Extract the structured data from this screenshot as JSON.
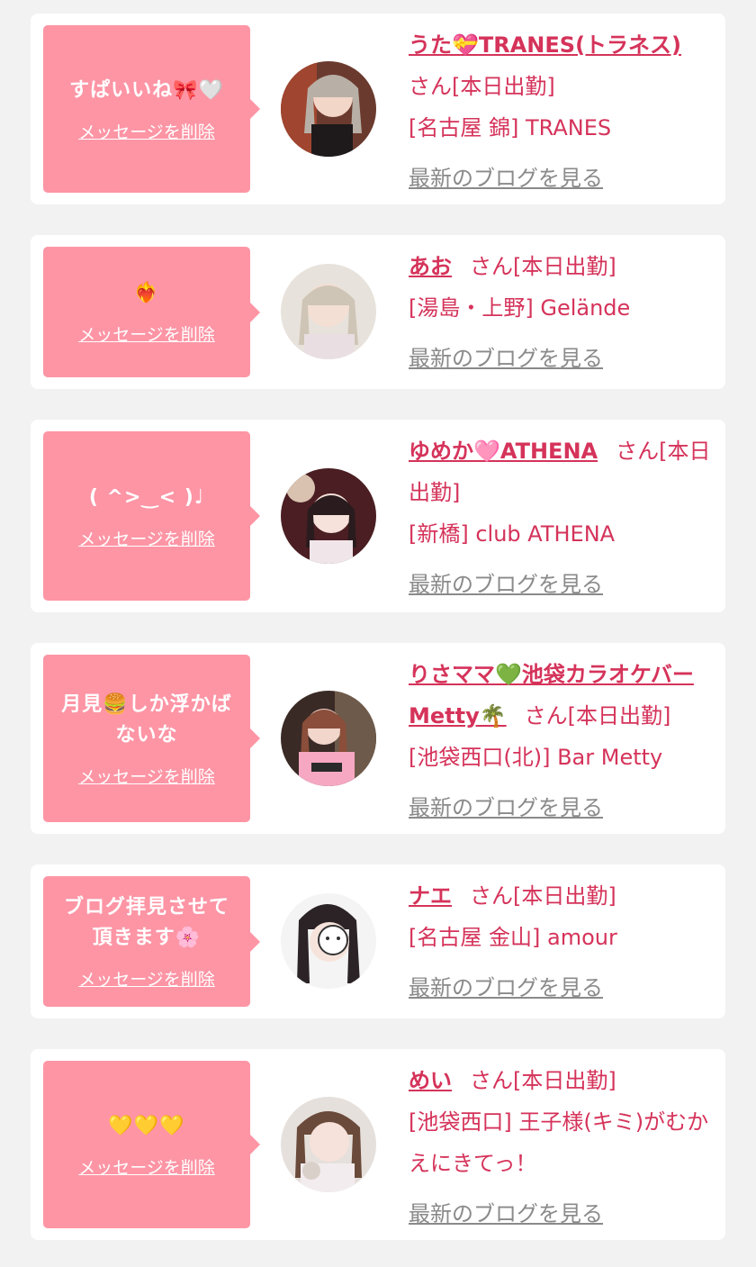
{
  "delete_label": "メッセージを削除",
  "blog_label": "最新のブログを見る",
  "colors": {
    "accent": "#d5335a",
    "bubble": "#fd95a5",
    "link_gray": "#8a8a8a",
    "card": "#ffffff",
    "background": "#f2f2f2"
  },
  "cards": [
    {
      "message_lines": [
        "すぱいいね🎀🤍"
      ],
      "name": "うた💝TRANES(トラネス)",
      "status": "さん[本日出勤]",
      "location": "[名古屋 錦] TRANES"
    },
    {
      "message_lines": [
        "❤️‍🔥"
      ],
      "name": "あお",
      "status": "さん[本日出勤]",
      "location": "[湯島・上野] Gelände"
    },
    {
      "message_lines": [
        "( ^>‿< )♩"
      ],
      "name": "ゆめか🩷ATHENA",
      "status": "さん[本日出勤]",
      "location": "[新橋] club ATHENA"
    },
    {
      "message_lines": [
        "月見🍔しか浮かば",
        "ないな"
      ],
      "name": "りさママ💚池袋カラオケバーMetty🌴",
      "status": "さん[本日出勤]",
      "location": "[池袋西口(北)] Bar Metty"
    },
    {
      "message_lines": [
        "ブログ拝見させて",
        "頂きます🌸"
      ],
      "name": "ナエ",
      "status": "さん[本日出勤]",
      "location": "[名古屋 金山] amour"
    },
    {
      "message_lines": [
        "💛💛💛"
      ],
      "name": "めい",
      "status": "さん[本日出勤]",
      "location": "[池袋西口] 王子様(キミ)がむかえにきてっ！"
    }
  ]
}
